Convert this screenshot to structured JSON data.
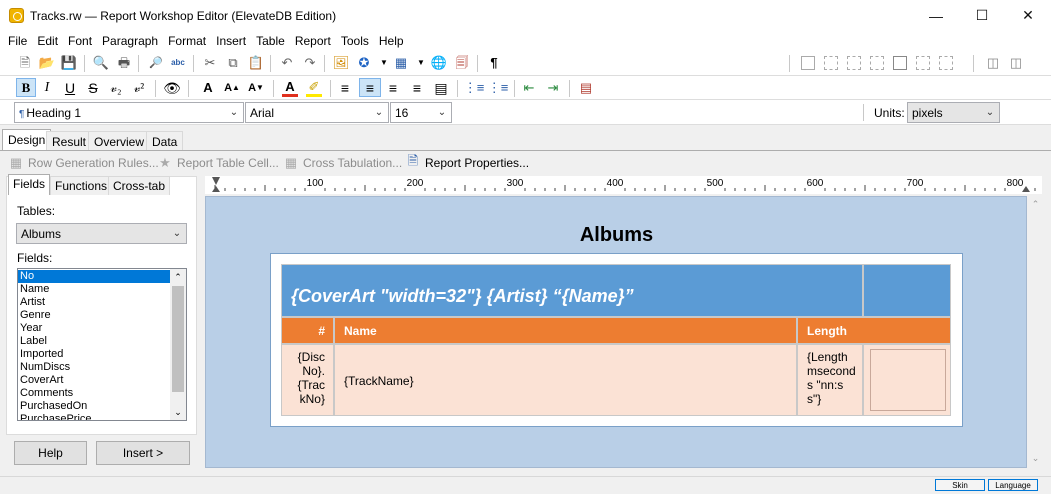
{
  "window": {
    "title": "Tracks.rw — Report Workshop Editor (ElevateDB Edition)"
  },
  "menu": [
    "File",
    "Edit",
    "Font",
    "Paragraph",
    "Format",
    "Insert",
    "Table",
    "Report",
    "Tools",
    "Help"
  ],
  "format_bar": {
    "style": "Heading 1",
    "font": "Arial",
    "size": "16",
    "units_label": "Units:",
    "units_value": "pixels"
  },
  "tabs": [
    "Design",
    "Result",
    "Overview",
    "Data"
  ],
  "commands": {
    "row_gen": "Row Generation Rules...",
    "table_cell": "Report Table Cell...",
    "cross_tab": "Cross Tabulation...",
    "report_props": "Report Properties..."
  },
  "left_panel": {
    "tabs": [
      "Fields",
      "Functions",
      "Cross-tab"
    ],
    "tables_label": "Tables:",
    "table_value": "Albums",
    "fields_label": "Fields:",
    "fields": [
      "No",
      "Name",
      "Artist",
      "Genre",
      "Year",
      "Label",
      "Imported",
      "NumDiscs",
      "CoverArt",
      "Comments",
      "PurchasedOn",
      "PurchasePrice"
    ],
    "help_button": "Help",
    "insert_button": "Insert >"
  },
  "ruler": [
    "100",
    "200",
    "300",
    "400",
    "500",
    "600",
    "700",
    "800"
  ],
  "document": {
    "title": "Albums",
    "header_row": "{CoverArt \"width=32\"} {Artist} “{Name}”",
    "col_headers": {
      "num": "#",
      "name": "Name",
      "length": "Length"
    },
    "cells": {
      "disc": "{Disc No}.{Trac kNo}",
      "track": "{TrackName}",
      "length": "{Length mseconds \"nn:ss\"}"
    }
  },
  "status": {
    "skin": "Skin",
    "language": "Language"
  },
  "colors": {
    "header_blue": "#5b9bd5",
    "header_orange": "#ed7d31",
    "cell_peach": "#fbe2d5",
    "editor_bg": "#b9cfe7"
  }
}
